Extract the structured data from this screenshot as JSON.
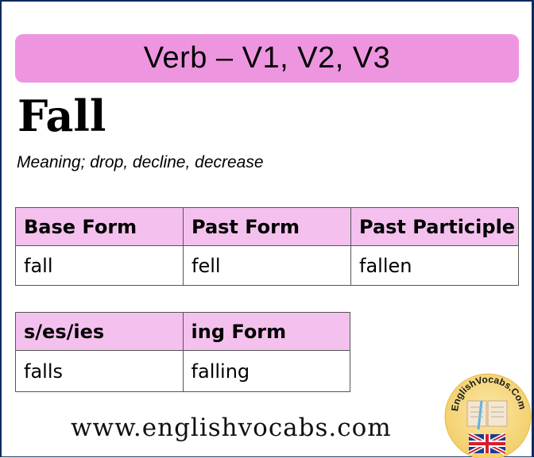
{
  "banner": {
    "title": "Verb – V1, V2, V3"
  },
  "word": "Fall",
  "meaning": "Meaning; drop, decline, decrease",
  "table_main": {
    "headers": [
      "Base Form",
      "Past Form",
      "Past Participle"
    ],
    "values": [
      "fall",
      "fell",
      "fallen"
    ]
  },
  "table_extra": {
    "headers": [
      "s/es/ies",
      "ing Form"
    ],
    "values": [
      "falls",
      "falling"
    ]
  },
  "footer": {
    "url": "www.englishvocabs.com"
  },
  "logo": {
    "text": "EnglishVocabs.Com",
    "icon": "book-and-uk-flag-icon"
  },
  "colors": {
    "banner": "#ee95e0",
    "header_cell": "#f4c1ee",
    "frame": "#0e2a5e"
  }
}
